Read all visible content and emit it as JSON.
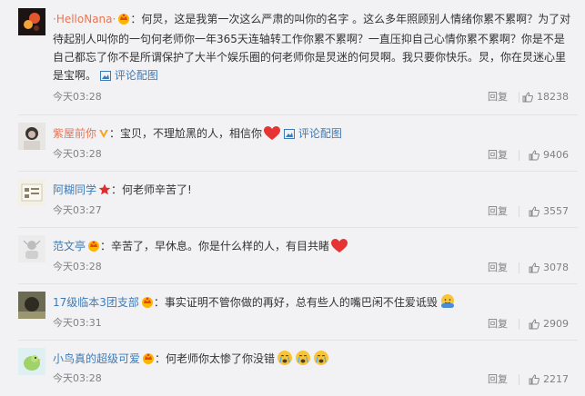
{
  "comments": [
    {
      "username": "·HelloNana·",
      "text": "何炅，这是我第一次这么严肃的叫你的名字 。这么多年照顾别人情绪你累不累啊？为了对待起别人叫你的一句何老师你一年365天连轴转工作你累不累啊？一直压抑自己心情你累不累啊？你是不是自己都忘了你不是所谓保护了大半个娱乐圈的何老师你是炅迷的何炅啊。我只要你快乐。炅，你在炅迷心里是宝啊。",
      "pic_link": "评论配图",
      "time": "今天03:28",
      "reply": "回复",
      "likes": "18238"
    },
    {
      "username": "紫屋前你",
      "text": "宝贝，不理尬黑的人，相信你",
      "pic_link": "评论配图",
      "time": "今天03:28",
      "reply": "回复",
      "likes": "9406"
    },
    {
      "username": "阿糊同学",
      "text": "何老师辛苦了!",
      "time": "今天03:27",
      "reply": "回复",
      "likes": "3557"
    },
    {
      "username": "范文亭",
      "text": "辛苦了，早休息。你是什么样的人，有目共睹",
      "time": "今天03:28",
      "reply": "回复",
      "likes": "3078"
    },
    {
      "username": "17级临本3团支部",
      "text": "事实证明不管你做的再好，总有些人的嘴巴闲不住爱诋毁",
      "time": "今天03:31",
      "reply": "回复",
      "likes": "2909"
    },
    {
      "username": "小鸟真的超级可爱",
      "text": "何老师你太惨了你没错",
      "time": "今天03:28",
      "reply": "回复",
      "likes": "2217"
    }
  ],
  "colors": {
    "username_orange": "#eb7350",
    "username_blue": "#3d7bb6",
    "link_blue": "#3d7bb6",
    "meta_gray": "#808080",
    "background": "#f2f2f5"
  },
  "icons": [
    "crown-badge-icon",
    "vip-v-icon",
    "star-badge-icon",
    "heart-emoji",
    "cry-emoji",
    "hug-emoji",
    "thumb-up-icon",
    "picture-icon"
  ]
}
